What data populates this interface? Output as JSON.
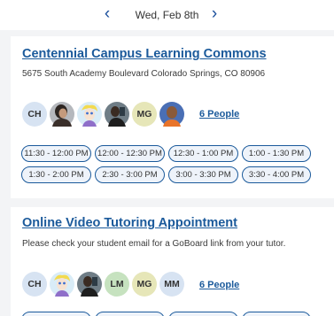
{
  "datebar": {
    "date": "Wed, Feb 8th",
    "prev_icon": "chevron-left-icon",
    "next_icon": "chevron-right-icon"
  },
  "locations": [
    {
      "title": "Centennial Campus Learning Commons",
      "subtitle": "5675 South Academy Boulevard Colorado Springs, CO 80906",
      "avatars": [
        {
          "type": "initials",
          "text": "CH"
        },
        {
          "type": "photo",
          "icon": "tutor-photo-1"
        },
        {
          "type": "photo",
          "icon": "tutor-photo-2"
        },
        {
          "type": "photo",
          "icon": "tutor-photo-3"
        },
        {
          "type": "initials",
          "text": "MG"
        },
        {
          "type": "photo",
          "icon": "tutor-photo-4"
        }
      ],
      "people_link": "6 People",
      "time_slots": [
        [
          "11:30 - 12:00 PM",
          "12:00 - 12:30 PM",
          "12:30 - 1:00 PM",
          "1:00 - 1:30 PM"
        ],
        [
          "1:30 - 2:00 PM",
          "2:30 - 3:00 PM",
          "3:00 - 3:30 PM",
          "3:30 - 4:00 PM"
        ]
      ]
    },
    {
      "title": "Online Video Tutoring Appointment",
      "subtitle": "Please check your student email for a GoBoard link from your tutor.",
      "avatars": [
        {
          "type": "initials",
          "text": "CH"
        },
        {
          "type": "photo",
          "icon": "tutor-photo-2"
        },
        {
          "type": "photo",
          "icon": "tutor-photo-3"
        },
        {
          "type": "initials",
          "text": "LM"
        },
        {
          "type": "initials",
          "text": "MG"
        },
        {
          "type": "initials",
          "text": "MM"
        }
      ],
      "people_link": "6 People"
    }
  ]
}
